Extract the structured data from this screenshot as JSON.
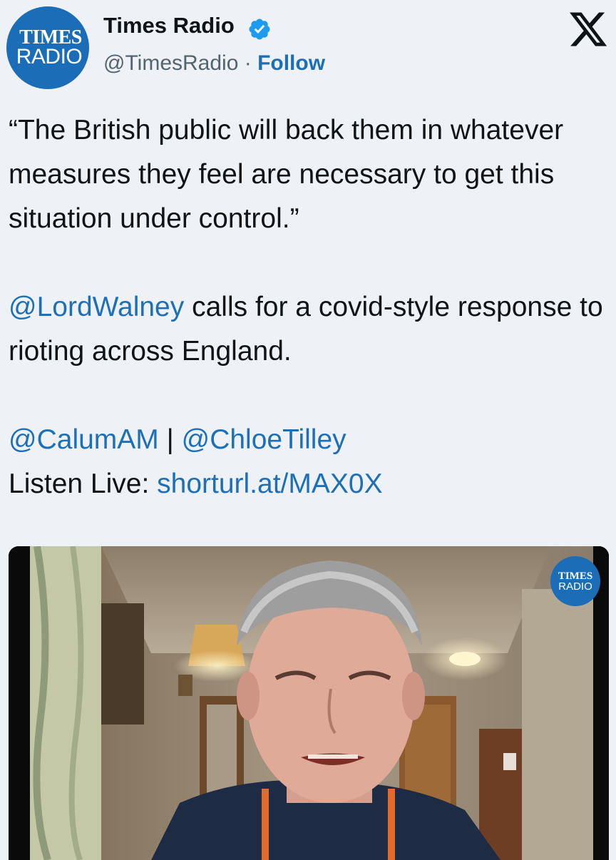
{
  "account": {
    "avatar_line1": "TIMES",
    "avatar_line2": "RADIO",
    "display_name": "Times Radio",
    "handle": "@TimesRadio",
    "separator": " · ",
    "follow_label": "Follow",
    "verified_icon": "verified-badge-icon"
  },
  "platform_icon": "x-logo-icon",
  "tweet": {
    "quote": "“The British public will back them in whatever measures they feel are necessary to get this situation under control.”",
    "mention_1": "@LordWalney",
    "sentence_rest": " calls for a covid-style response to rioting across England.",
    "mention_2": "@CalumAM",
    "divider": " | ",
    "mention_3": "@ChloeTilley",
    "listen_label": "Listen Live: ",
    "listen_link": "shorturl.at/MAX0X"
  },
  "video": {
    "logo_line1": "TIMES",
    "logo_line2": "RADIO"
  },
  "colors": {
    "background": "#eef2f6",
    "brand_blue": "#1b6db8",
    "link_blue": "#1d6fb8",
    "text": "#0f1419",
    "secondary_text": "#536471"
  }
}
